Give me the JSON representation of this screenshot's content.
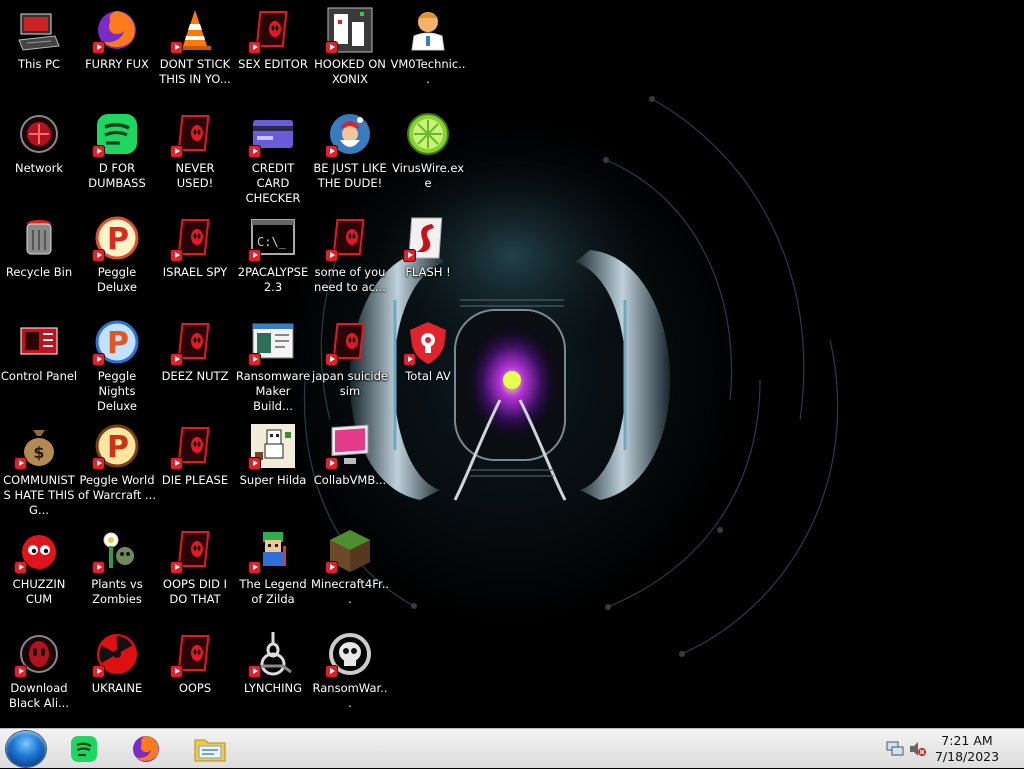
{
  "desktop": {
    "icons": [
      {
        "label": "This PC",
        "icon": "computer-icon"
      },
      {
        "label": "Network",
        "icon": "network-icon"
      },
      {
        "label": "Recycle Bin",
        "icon": "recycle-bin-icon"
      },
      {
        "label": "Control Panel",
        "icon": "control-panel-icon"
      },
      {
        "label": "COMMUNISTS HATE THIS G...",
        "icon": "money-bag-icon"
      },
      {
        "label": "CHUZZIN CUM",
        "icon": "red-fuzzball-icon"
      },
      {
        "label": "Download Black Ali...",
        "icon": "alien-head-icon"
      },
      {
        "label": "FURRY FUX",
        "icon": "firefox-icon"
      },
      {
        "label": "D FOR DUMBASS",
        "icon": "spotify-style-icon"
      },
      {
        "label": "Peggle Deluxe",
        "icon": "peggle-icon"
      },
      {
        "label": "Peggle Nights Deluxe",
        "icon": "peggle-nights-icon"
      },
      {
        "label": "Peggle World of Warcraft ...",
        "icon": "peggle-wow-icon"
      },
      {
        "label": "Plants vs Zombies",
        "icon": "plants-vs-zombies-icon"
      },
      {
        "label": "UKRAINE",
        "icon": "radiation-icon"
      },
      {
        "label": "DONT STICK THIS IN YO...",
        "icon": "traffic-cone-icon"
      },
      {
        "label": "NEVER USED!",
        "icon": "alien-file-icon"
      },
      {
        "label": "ISRAEL SPY",
        "icon": "alien-file-icon"
      },
      {
        "label": "DEEZ NUTZ",
        "icon": "alien-file-icon"
      },
      {
        "label": "DIE PLEASE",
        "icon": "alien-file-icon"
      },
      {
        "label": "OOPS DID I DO THAT",
        "icon": "alien-file-icon"
      },
      {
        "label": "OOPS",
        "icon": "alien-file-icon"
      },
      {
        "label": "SEX EDITOR",
        "icon": "alien-file-icon"
      },
      {
        "label": "CREDIT CARD CHECKER",
        "icon": "credit-card-icon"
      },
      {
        "label": "2PACALYPSE 2.3",
        "icon": "console-icon"
      },
      {
        "label": "Ransomware Maker Build...",
        "icon": "app-window-icon"
      },
      {
        "label": "Super Hilda",
        "icon": "pixel-game-icon"
      },
      {
        "label": "The Legend of Zilda",
        "icon": "zelda-character-icon"
      },
      {
        "label": "LYNCHING",
        "icon": "noose-icon"
      },
      {
        "label": "HOOKED ON XONIX",
        "icon": "xonix-game-icon"
      },
      {
        "label": "BE JUST LIKE THE DUDE!",
        "icon": "santa-globe-icon"
      },
      {
        "label": "some of you need to ac...",
        "icon": "alien-file-icon"
      },
      {
        "label": "japan suicide sim",
        "icon": "alien-file-icon"
      },
      {
        "label": "CollabVMB...",
        "icon": "monitor-icon"
      },
      {
        "label": "Minecraft4Fr...",
        "icon": "minecraft-icon"
      },
      {
        "label": "RansomWar...",
        "icon": "skull-icon"
      },
      {
        "label": "VM0Technic...",
        "icon": "doctor-icon"
      },
      {
        "label": "VirusWire.exe",
        "icon": "limewire-icon"
      },
      {
        "label": "FLASH !",
        "icon": "flash-icon"
      },
      {
        "label": "Total AV",
        "icon": "shield-lock-icon"
      }
    ]
  },
  "taskbar": {
    "start_icon": "start-orb-icon",
    "pinned": [
      {
        "name": "spotify-style",
        "icon": "spotify-style-icon"
      },
      {
        "name": "firefox",
        "icon": "firefox-icon"
      },
      {
        "name": "file-explorer",
        "icon": "folder-icon"
      }
    ],
    "tray": {
      "network_icon": "network-tray-icon",
      "volume_icon": "volume-muted-icon",
      "time": "7:21 AM",
      "date": "7/18/2023"
    }
  },
  "colors": {
    "desktop_bg": "#000000",
    "taskbar_bg": "#e6e6e6",
    "accent_red": "#e0202a"
  }
}
